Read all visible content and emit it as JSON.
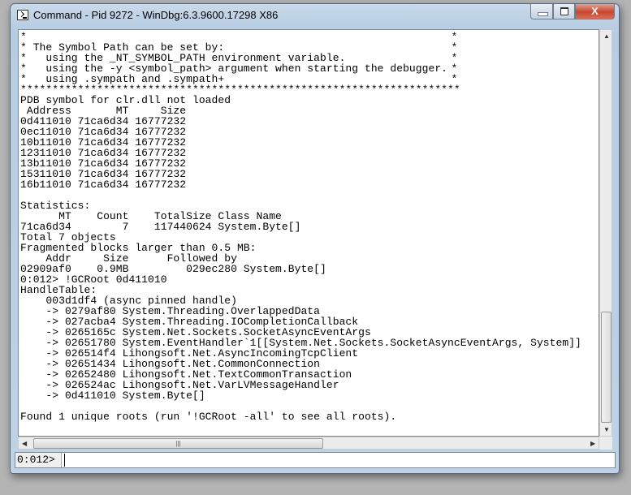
{
  "window": {
    "title": "Command - Pid 9272 - WinDbg:6.3.9600.17298 X86",
    "close_glyph": "X"
  },
  "output": {
    "banner": [
      {
        "text": "*",
        "edge": "*"
      },
      {
        "text": "* The Symbol Path can be set by:",
        "edge": "*"
      },
      {
        "text": "*   using the _NT_SYMBOL_PATH environment variable.",
        "edge": "*"
      },
      {
        "text": "*   using the -y <symbol_path> argument when starting the debugger.",
        "edge": "*"
      },
      {
        "text": "*   using .sympath and .sympath+",
        "edge": "*"
      }
    ],
    "lines": [
      "*********************************************************************",
      "PDB symbol for clr.dll not loaded",
      " Address       MT     Size",
      "0d411010 71ca6d34 16777232",
      "0ec11010 71ca6d34 16777232",
      "10b11010 71ca6d34 16777232",
      "12311010 71ca6d34 16777232",
      "13b11010 71ca6d34 16777232",
      "15311010 71ca6d34 16777232",
      "16b11010 71ca6d34 16777232",
      "",
      "Statistics:",
      "      MT    Count    TotalSize Class Name",
      "71ca6d34        7    117440624 System.Byte[]",
      "Total 7 objects",
      "Fragmented blocks larger than 0.5 MB:",
      "    Addr     Size      Followed by",
      "02909af0    0.9MB         029ec280 System.Byte[]",
      "0:012> !GCRoot 0d411010",
      "HandleTable:",
      "    003d1df4 (async pinned handle)",
      "    -> 0279af80 System.Threading.OverlappedData",
      "    -> 027acba4 System.Threading.IOCompletionCallback",
      "    -> 0265165c System.Net.Sockets.SocketAsyncEventArgs",
      "    -> 02651780 System.EventHandler`1[[System.Net.Sockets.SocketAsyncEventArgs, System]]",
      "    -> 026514f4 Lihongsoft.Net.AsyncIncomingTcpClient",
      "    -> 02651434 Lihongsoft.Net.CommonConnection",
      "    -> 02652480 Lihongsoft.Net.TextCommonTransaction",
      "    -> 026524ac Lihongsoft.Net.VarLVMessageHandler",
      "    -> 0d411010 System.Byte[]",
      "",
      "Found 1 unique roots (run '!GCRoot -all' to see all roots)."
    ]
  },
  "input": {
    "prompt": "0:012>",
    "value": ""
  },
  "icons": {
    "app": "console-icon",
    "minimize": "minimize-icon",
    "maximize": "maximize-icon",
    "close": "close-icon"
  }
}
